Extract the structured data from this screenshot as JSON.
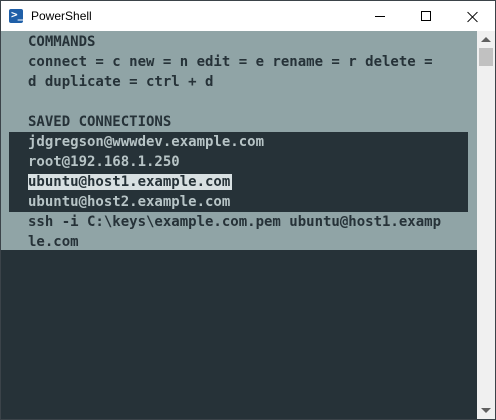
{
  "window": {
    "title": "PowerShell",
    "icon": "powershell-icon"
  },
  "titlebar_controls": [
    "minimize-icon",
    "maximize-icon",
    "close-icon"
  ],
  "terminal": {
    "commands_heading": "COMMANDS",
    "commands_line1": "connect = c new = n edit = e rename = r delete =",
    "commands_line2": "d duplicate = ctrl + d",
    "saved_heading": "SAVED CONNECTIONS",
    "connections": [
      "jdgregson@wwwdev.example.com",
      "root@192.168.1.250",
      "ubuntu@host1.example.com",
      "ubuntu@host2.example.com"
    ],
    "selected_index": 2,
    "command_line1": "ssh -i C:\\keys\\example.com.pem ubuntu@host1.examp",
    "command_line2": "le.com"
  },
  "colors": {
    "terminal_bg": "#263238",
    "menu_bg": "#90a4a6",
    "titlebar_bg": "#ffffff"
  }
}
